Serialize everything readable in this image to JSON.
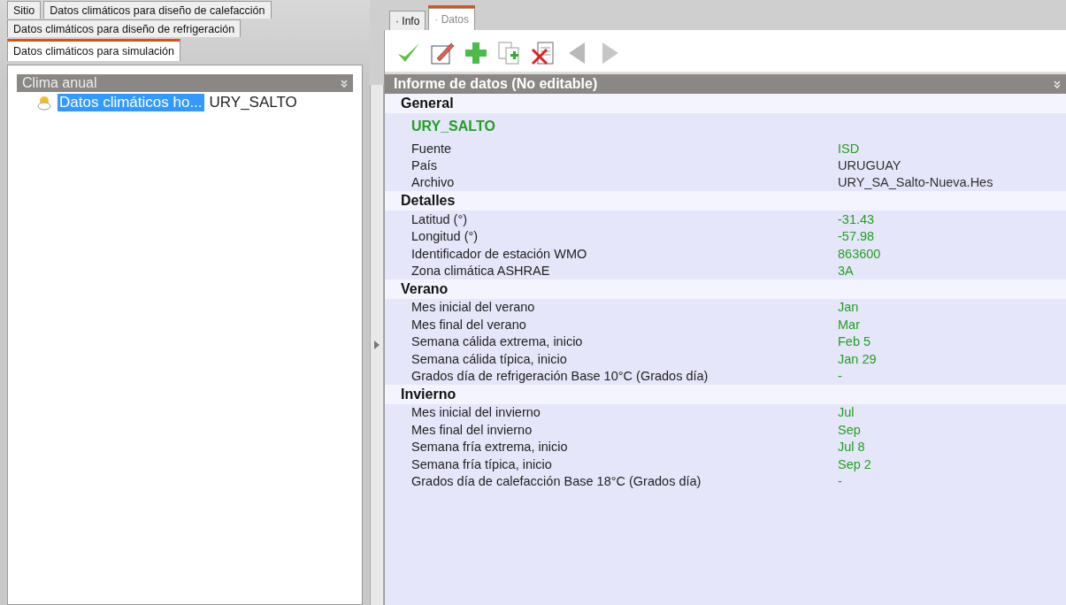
{
  "left_tabs": [
    [
      {
        "label": "Sitio",
        "selected": false
      },
      {
        "label": "Datos climáticos para diseño de calefacción",
        "selected": false
      }
    ],
    [
      {
        "label": "Datos climáticos para diseño de refrigeración",
        "selected": false
      }
    ],
    [
      {
        "label": "Datos climáticos para simulación",
        "selected": true
      }
    ]
  ],
  "tree": {
    "header": "Clima anual",
    "items": [
      {
        "label": "Datos climáticos ho...",
        "value": "URY_SALTO",
        "selected": true
      }
    ]
  },
  "right_tabs": [
    {
      "label": "· Info",
      "selected": false
    },
    {
      "label": "· Datos",
      "selected": true
    }
  ],
  "toolbar": [
    {
      "kind": "check",
      "disabled": false
    },
    {
      "kind": "edit",
      "disabled": false
    },
    {
      "kind": "add",
      "disabled": false
    },
    {
      "kind": "copy",
      "disabled": false
    },
    {
      "kind": "delete",
      "disabled": false
    },
    {
      "kind": "prev",
      "disabled": true
    },
    {
      "kind": "next",
      "disabled": true
    }
  ],
  "report": {
    "title": "Informe de datos (No editable)",
    "sections": [
      {
        "title": "General",
        "name": "URY_SALTO",
        "rows": [
          {
            "label": "Fuente",
            "value": "ISD",
            "color": "#22a020"
          },
          {
            "label": "País",
            "value": "URUGUAY",
            "color": "#303030"
          },
          {
            "label": "Archivo",
            "value": "URY_SA_Salto-Nueva.Hes",
            "color": "#303030"
          }
        ]
      },
      {
        "title": "Detalles",
        "rows": [
          {
            "label": "Latitud (°)",
            "value": "-31.43",
            "color": "#22a020"
          },
          {
            "label": "Longitud (°)",
            "value": "-57.98",
            "color": "#22a020"
          },
          {
            "label": "Identificador de estación WMO",
            "value": "863600",
            "color": "#22a020"
          },
          {
            "label": "Zona climática ASHRAE",
            "value": "3A",
            "color": "#22a020"
          }
        ]
      },
      {
        "title": "Verano",
        "rows": [
          {
            "label": "Mes inicial del verano",
            "value": "Jan",
            "color": "#22a020"
          },
          {
            "label": "Mes final del verano",
            "value": "Mar",
            "color": "#22a020"
          },
          {
            "label": "Semana cálida extrema, inicio",
            "value": "Feb 5",
            "color": "#22a020"
          },
          {
            "label": "Semana cálida típica, inicio",
            "value": "Jan 29",
            "color": "#22a020"
          },
          {
            "label": "Grados día de refrigeración Base 10°C (Grados día)",
            "value": "-",
            "color": "#22a020"
          }
        ]
      },
      {
        "title": "Invierno",
        "rows": [
          {
            "label": "Mes inicial del invierno",
            "value": "Jul",
            "color": "#22a020"
          },
          {
            "label": "Mes final del invierno",
            "value": "Sep",
            "color": "#22a020"
          },
          {
            "label": "Semana fría extrema, inicio",
            "value": "Jul 8",
            "color": "#22a020"
          },
          {
            "label": "Semana fría típica, inicio",
            "value": "Sep 2",
            "color": "#22a020"
          },
          {
            "label": "Grados día de calefacción Base 18°C (Grados día)",
            "value": "-",
            "color": "#22a020"
          }
        ]
      }
    ]
  }
}
